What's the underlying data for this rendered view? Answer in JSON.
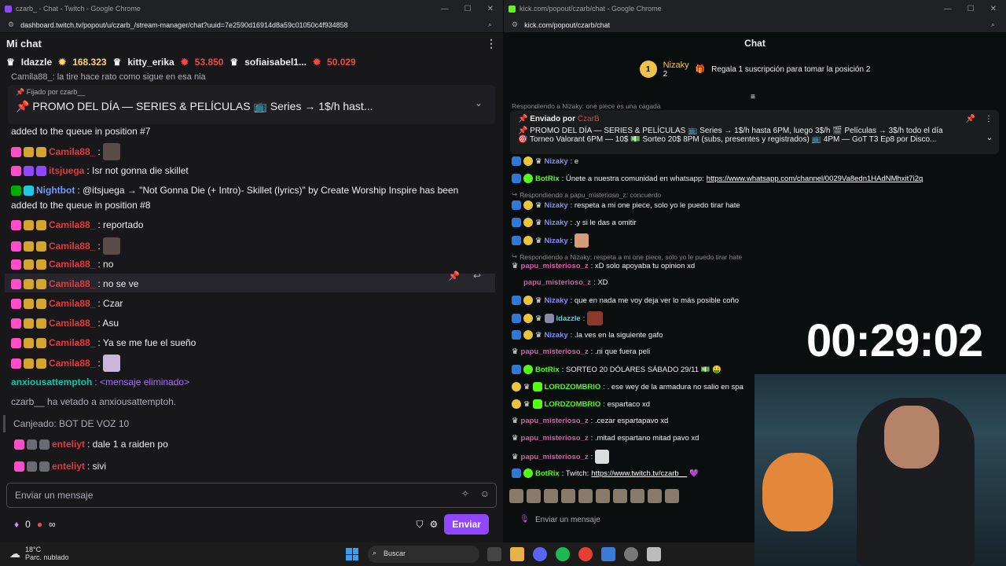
{
  "twitch": {
    "window_title": "czarb_ - Chat - Twitch - Google Chrome",
    "url": "dashboard.twitch.tv/popout/u/czarb_/stream-manager/chat?uuid=7e2590d16914d8a59c01050c4f934858",
    "chat_title": "Mi chat",
    "top_chatters": [
      {
        "name": "Idazzle",
        "amount": ""
      },
      {
        "name": "",
        "amount": "168.323"
      },
      {
        "name": "kitty_erika",
        "amount": ""
      },
      {
        "name": "",
        "amount": "53.850"
      },
      {
        "name": "sofiaisabel1...",
        "amount": ""
      },
      {
        "name": "",
        "amount": "50.029"
      }
    ],
    "partial_top": "Camila88_: la tire hace rato como sigue en esa nia",
    "pinned_by": "Fijado por",
    "pinned_user": "czarb__",
    "pinned_text": "📌 PROMO DEL DÍA — SERIES & PELÍCULAS 📺 Series → 1$/h hast...",
    "messages": [
      {
        "user": "",
        "text": "added to the queue in position #7"
      },
      {
        "user": "Camila88_",
        "text": ":"
      },
      {
        "user": "itsjuega",
        "text": ": Isr not gonna die skillet"
      },
      {
        "user": "Nightbot",
        "text": ": @itsjuega → \"Not Gonna Die (+ Intro)- Skillet (lyrics)\" by Create Worship Inspire has been"
      },
      {
        "user": "",
        "text": "added to the queue in position #8"
      },
      {
        "user": "Camila88_",
        "text": ": reportado"
      },
      {
        "user": "Camila88_",
        "text": ":"
      },
      {
        "user": "Camila88_",
        "text": ": no"
      },
      {
        "user": "Camila88_",
        "text": ": no se ve"
      },
      {
        "user": "Camila88_",
        "text": ": Czar"
      },
      {
        "user": "Camila88_",
        "text": ": Asu"
      },
      {
        "user": "Camila88_",
        "text": ": Ya se me fue el sueño"
      },
      {
        "user": "Camila88_",
        "text": ":"
      },
      {
        "user": "anxiousattemptoh",
        "text": ": <mensaje eliminado>"
      },
      {
        "user": "",
        "text": "czarb__ ha vetado a anxiousattemptoh."
      },
      {
        "user": "",
        "text": "Canjeado: BOT DE VOZ 10"
      },
      {
        "user": "enteliyt",
        "text": ": dale 1 a raiden po"
      },
      {
        "user": "enteliyt",
        "text": ": sivi"
      }
    ],
    "input_placeholder": "Enviar un mensaje",
    "points": "0",
    "infinity": "∞",
    "send_label": "Enviar"
  },
  "kick": {
    "window_title": "kick.com/popout/czarb/chat - Google Chrome",
    "url": "kick.com/popout/czarb/chat",
    "chat_title": "Chat",
    "rank": "1",
    "top_user": "Nizaky",
    "top_count": "2",
    "top_hint": "Regala 1 suscripción para tomar la posición 2",
    "partial_reply": "Respondiendo a Nizaky: one piece es una cagada",
    "pinned_label": "Enviado por",
    "pinned_user": "CzarB",
    "pinned_line1": "📌 PROMO DEL DÍA — SERIES & PELÍCULAS 📺 Series → 1$/h hasta 6PM, luego 3$/h 🎬 Películas → 3$/h todo el día",
    "pinned_line2": "🎯 Torneo Valorant 6PM — 10$ 💵 Sorteo 20$ 8PM (subs, presentes y registrados) 📺 4PM — GoT T3 Ep8 por Disco...",
    "messages": [
      {
        "kind": "msg",
        "user": "Nizaky",
        "text": ": e"
      },
      {
        "kind": "msg",
        "user": "BotRix",
        "text": ": Únete a nuestra comunidad en whatsapp: ",
        "link": "https://www.whatsapp.com/channel/0029Va8edn1HAdNMhxit7i2q"
      },
      {
        "kind": "reply",
        "text": "Respondiendo a papu_misterioso_z: concuerdo"
      },
      {
        "kind": "msg",
        "user": "Nizaky",
        "text": ": respeta a mi one piece, solo yo le puedo tirar hate"
      },
      {
        "kind": "msg",
        "user": "Nizaky",
        "text": ": .y si le das a omitir"
      },
      {
        "kind": "msg",
        "user": "Nizaky",
        "text": ":"
      },
      {
        "kind": "reply",
        "text": "Respondiendo a Nizaky: respeta a mi one piece, solo yo le puedo tirar hate"
      },
      {
        "kind": "msg",
        "user": "papu_misterioso_z",
        "text": ": xD solo apoyaba tu opinion xd"
      },
      {
        "kind": "msg",
        "user": "papu_misterioso_z",
        "text": ": XD"
      },
      {
        "kind": "msg",
        "user": "Nizaky",
        "text": ": que en nada me voy deja ver lo más posible coño"
      },
      {
        "kind": "msg",
        "user": "Idazzle",
        "text": ":"
      },
      {
        "kind": "msg",
        "user": "Nizaky",
        "text": ": .la ves en la siguiente gafo"
      },
      {
        "kind": "msg",
        "user": "papu_misterioso_z",
        "text": ": .ni que fuera peli"
      },
      {
        "kind": "msg",
        "user": "BotRix",
        "text": ": SORTEO 20 DÓLARES SÁBADO 29/11 💵 🤑"
      },
      {
        "kind": "msg",
        "user": "LORDZOMBRIO",
        "text": ": . ese wey de la armadura no salio en spa"
      },
      {
        "kind": "msg",
        "user": "LORDZOMBRIO",
        "text": ": espartaco xd"
      },
      {
        "kind": "msg",
        "user": "papu_misterioso_z",
        "text": ": .cezar espartapavo xd"
      },
      {
        "kind": "msg",
        "user": "papu_misterioso_z",
        "text": ": .mitad espartano mitad pavo xd"
      },
      {
        "kind": "msg",
        "user": "papu_misterioso_z",
        "text": ":"
      },
      {
        "kind": "msg",
        "user": "BotRix",
        "text": ": Twitch: ",
        "link": "https://www.twitch.tv/czarb__",
        "after": " 💜"
      }
    ],
    "input_placeholder": "Enviar un mensaje"
  },
  "overlay": {
    "timer": "00:29:02"
  },
  "taskbar": {
    "temp": "18°C",
    "weather": "Parc. nublado",
    "search": "Buscar"
  },
  "colors": {
    "twitch_purple": "#9147ff",
    "kick_green": "#53fc18"
  }
}
